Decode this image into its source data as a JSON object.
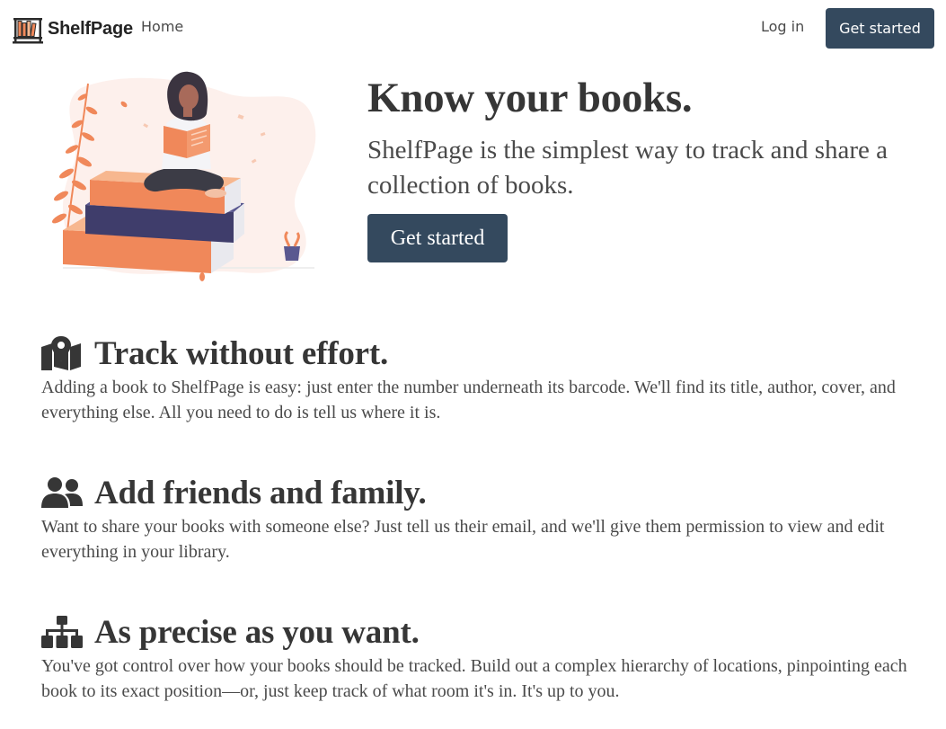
{
  "navbar": {
    "brand": "ShelfPage",
    "brand_icon": "bookshelf-icon",
    "home": "Home",
    "login": "Log in",
    "cta": "Get started"
  },
  "hero": {
    "illustration": "reading-on-books-illustration",
    "title": "Know your books.",
    "subtitle": "ShelfPage is the simplest way to track and share a collection of books.",
    "cta": "Get started"
  },
  "features": [
    {
      "icon": "map-marker-icon",
      "title": "Track without effort.",
      "text": "Adding a book to ShelfPage is easy: just enter the number underneath its barcode. We'll find its title, author, cover, and everything else. All you need to do is tell us where it is."
    },
    {
      "icon": "users-icon",
      "title": "Add friends and family.",
      "text": "Want to share your books with someone else? Just tell us their email, and we'll give them permission to view and edit everything in your library."
    },
    {
      "icon": "sitemap-icon",
      "title": "As precise as you want.",
      "text": "You've got control over how your books should be tracked. Build out a complex hierarchy of locations, pinpointing each book to its exact position—or, just keep track of what room it's in. It's up to you."
    }
  ],
  "colors": {
    "primary": "#34495e",
    "accent": "#f0885a",
    "text": "#363636"
  }
}
